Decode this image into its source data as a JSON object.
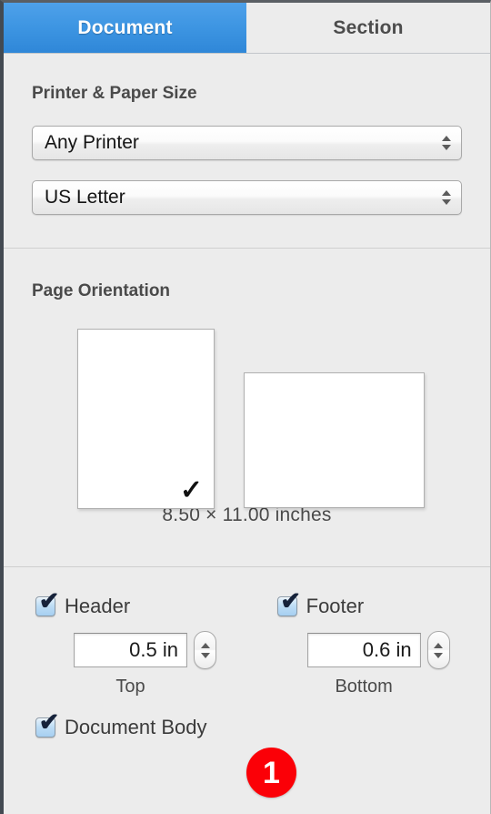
{
  "tabs": [
    {
      "label": "Document",
      "active": true
    },
    {
      "label": "Section",
      "active": false
    }
  ],
  "printer_section": {
    "title": "Printer & Paper Size",
    "printer": {
      "value": "Any Printer"
    },
    "paper_size": {
      "value": "US Letter"
    }
  },
  "orientation_section": {
    "title": "Page Orientation",
    "portrait": {
      "selected_mark": "✓"
    },
    "landscape": {
      "selected_mark": ""
    },
    "dimensions": "8.50 × 11.00 inches"
  },
  "margins_section": {
    "header": {
      "checkbox_label": "Header",
      "checked_mark": "✔",
      "value": "0.5 in",
      "sublabel": "Top"
    },
    "footer": {
      "checkbox_label": "Footer",
      "checked_mark": "✔",
      "value": "0.6 in",
      "sublabel": "Bottom"
    },
    "document_body": {
      "checkbox_label": "Document Body",
      "checked_mark": "✔"
    }
  },
  "annotation": {
    "badge_number": "1",
    "badge_color": "#fb0007"
  }
}
